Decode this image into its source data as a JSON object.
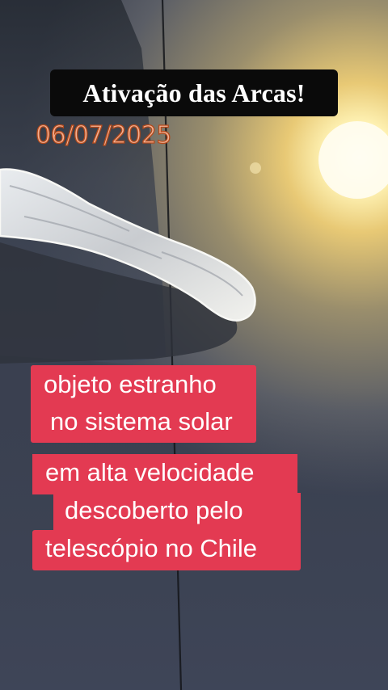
{
  "title": "Ativação das Arcas!",
  "date": "06/07/2025",
  "caption_top": {
    "line1": "objeto estranho",
    "line2": "no sistema solar"
  },
  "caption_bottom": {
    "line1": "em alta velocidade",
    "line2": "descoberto pelo",
    "line3": "telescópio no Chile"
  },
  "colors": {
    "caption_bg": "#e33a52",
    "title_bg": "#0a0a0a",
    "date_fill": "#f3b193",
    "date_outline": "#b34a1c"
  }
}
